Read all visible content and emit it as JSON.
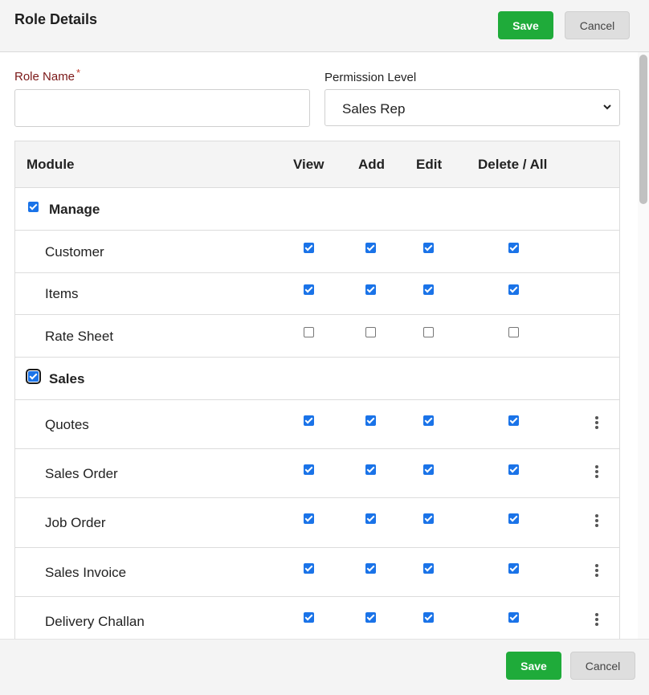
{
  "header": {
    "title": "Role Details",
    "save_label": "Save",
    "cancel_label": "Cancel"
  },
  "form": {
    "role_name_label": "Role Name",
    "required_mark": "*",
    "role_name_value": "",
    "permission_level_label": "Permission Level",
    "permission_level_value": "Sales Rep"
  },
  "table": {
    "columns": [
      "Module",
      "View",
      "Add",
      "Edit",
      "Delete / All"
    ],
    "groups": [
      {
        "name": "Manage",
        "checked": true,
        "focused": false,
        "items": [
          {
            "name": "Customer",
            "view": true,
            "add": true,
            "edit": true,
            "delete": true,
            "menu": false
          },
          {
            "name": "Items",
            "view": true,
            "add": true,
            "edit": true,
            "delete": true,
            "menu": false
          },
          {
            "name": "Rate Sheet",
            "view": false,
            "add": false,
            "edit": false,
            "delete": false,
            "menu": false
          }
        ]
      },
      {
        "name": "Sales",
        "checked": true,
        "focused": true,
        "items": [
          {
            "name": "Quotes",
            "view": true,
            "add": true,
            "edit": true,
            "delete": true,
            "menu": true
          },
          {
            "name": "Sales Order",
            "view": true,
            "add": true,
            "edit": true,
            "delete": true,
            "menu": true
          },
          {
            "name": "Job Order",
            "view": true,
            "add": true,
            "edit": true,
            "delete": true,
            "menu": true
          },
          {
            "name": "Sales Invoice",
            "view": true,
            "add": true,
            "edit": true,
            "delete": true,
            "menu": true
          },
          {
            "name": "Delivery Challan",
            "view": true,
            "add": true,
            "edit": true,
            "delete": true,
            "menu": true
          }
        ]
      }
    ]
  },
  "footer": {
    "save_label": "Save",
    "cancel_label": "Cancel"
  },
  "colors": {
    "save": "#1fab3a",
    "checkbox": "#1a73e8",
    "required_label": "#7a1717"
  }
}
